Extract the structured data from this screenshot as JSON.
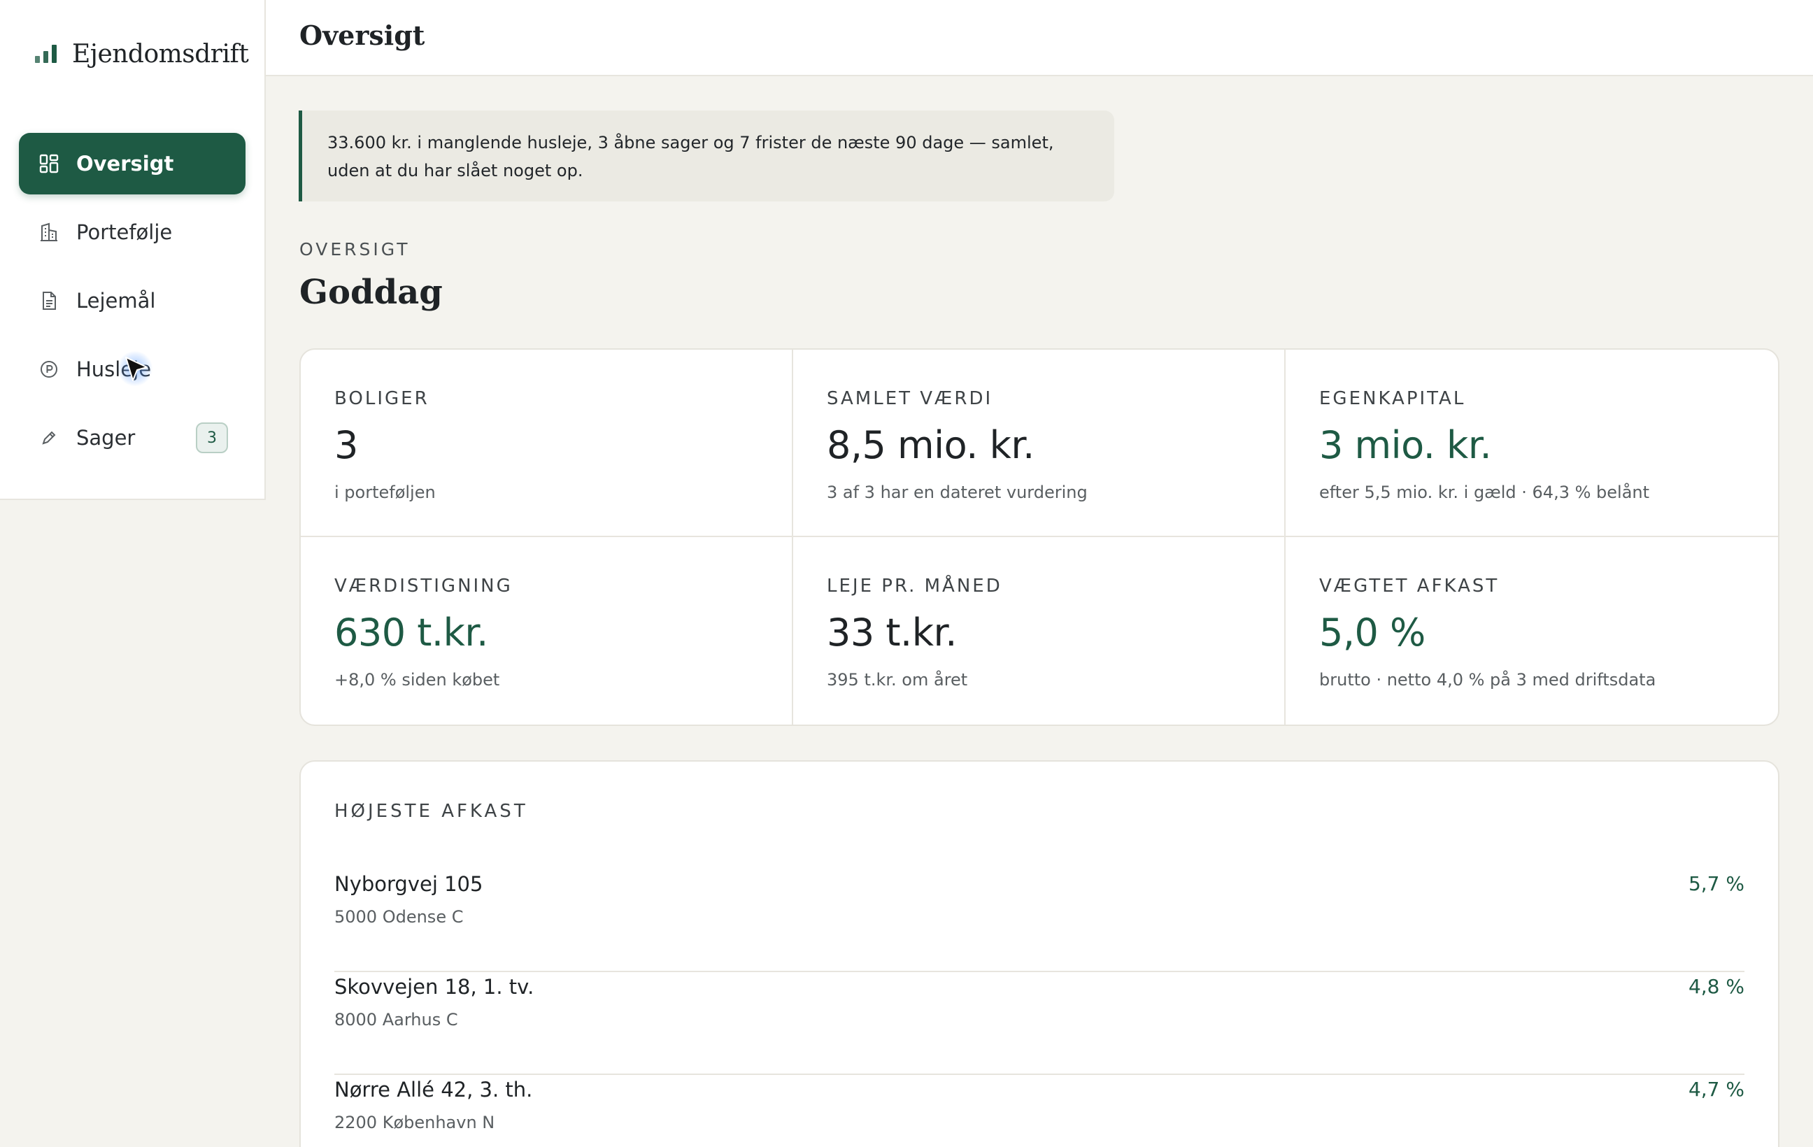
{
  "app": {
    "name": "Ejendomsdrift"
  },
  "sidebar": {
    "items": [
      {
        "label": "Oversigt",
        "icon": "dashboard-icon",
        "active": true
      },
      {
        "label": "Portefølje",
        "icon": "building-icon"
      },
      {
        "label": "Lejemål",
        "icon": "document-icon"
      },
      {
        "label": "Husleje",
        "icon": "coin-icon"
      },
      {
        "label": "Sager",
        "icon": "pencil-icon",
        "badge": "3"
      }
    ]
  },
  "header": {
    "title": "Oversigt"
  },
  "notice": {
    "text": "33.600 kr. i manglende husleje, 3 åbne sager og 7 frister de næste 90 dage — samlet, uden at du har slået noget op."
  },
  "overview": {
    "eyebrow": "OVERSIGT",
    "greeting": "Goddag"
  },
  "stats": [
    {
      "label": "BOLIGER",
      "value": "3",
      "sub": "i porteføljen"
    },
    {
      "label": "SAMLET VÆRDI",
      "value": "8,5 mio. kr.",
      "sub": "3 af 3 har en dateret vurdering"
    },
    {
      "label": "EGENKAPITAL",
      "value": "3 mio. kr.",
      "sub": "efter 5,5 mio. kr. i gæld · 64,3 % belånt"
    },
    {
      "label": "VÆRDISTIGNING",
      "value": "630 t.kr.",
      "sub": "+8,0 % siden købet"
    },
    {
      "label": "LEJE PR. MÅNED",
      "value": "33 t.kr.",
      "sub": "395 t.kr. om året"
    },
    {
      "label": "VÆGTET AFKAST",
      "value": "5,0 %",
      "sub": "brutto · netto 4,0 % på 3 med driftsdata"
    }
  ],
  "top_yield": {
    "title": "HØJESTE AFKAST",
    "rows": [
      {
        "address": "Nyborgvej 105",
        "city": "5000 Odense C",
        "yield": "5,7 %"
      },
      {
        "address": "Skovvejen 18, 1. tv.",
        "city": "8000 Aarhus C",
        "yield": "4,8 %"
      },
      {
        "address": "Nørre Allé 42, 3. th.",
        "city": "2200 København N",
        "yield": "4,7 %"
      }
    ]
  },
  "colors": {
    "accent": "#1e5a44",
    "background": "#f4f3ee",
    "surface": "#ffffff"
  }
}
